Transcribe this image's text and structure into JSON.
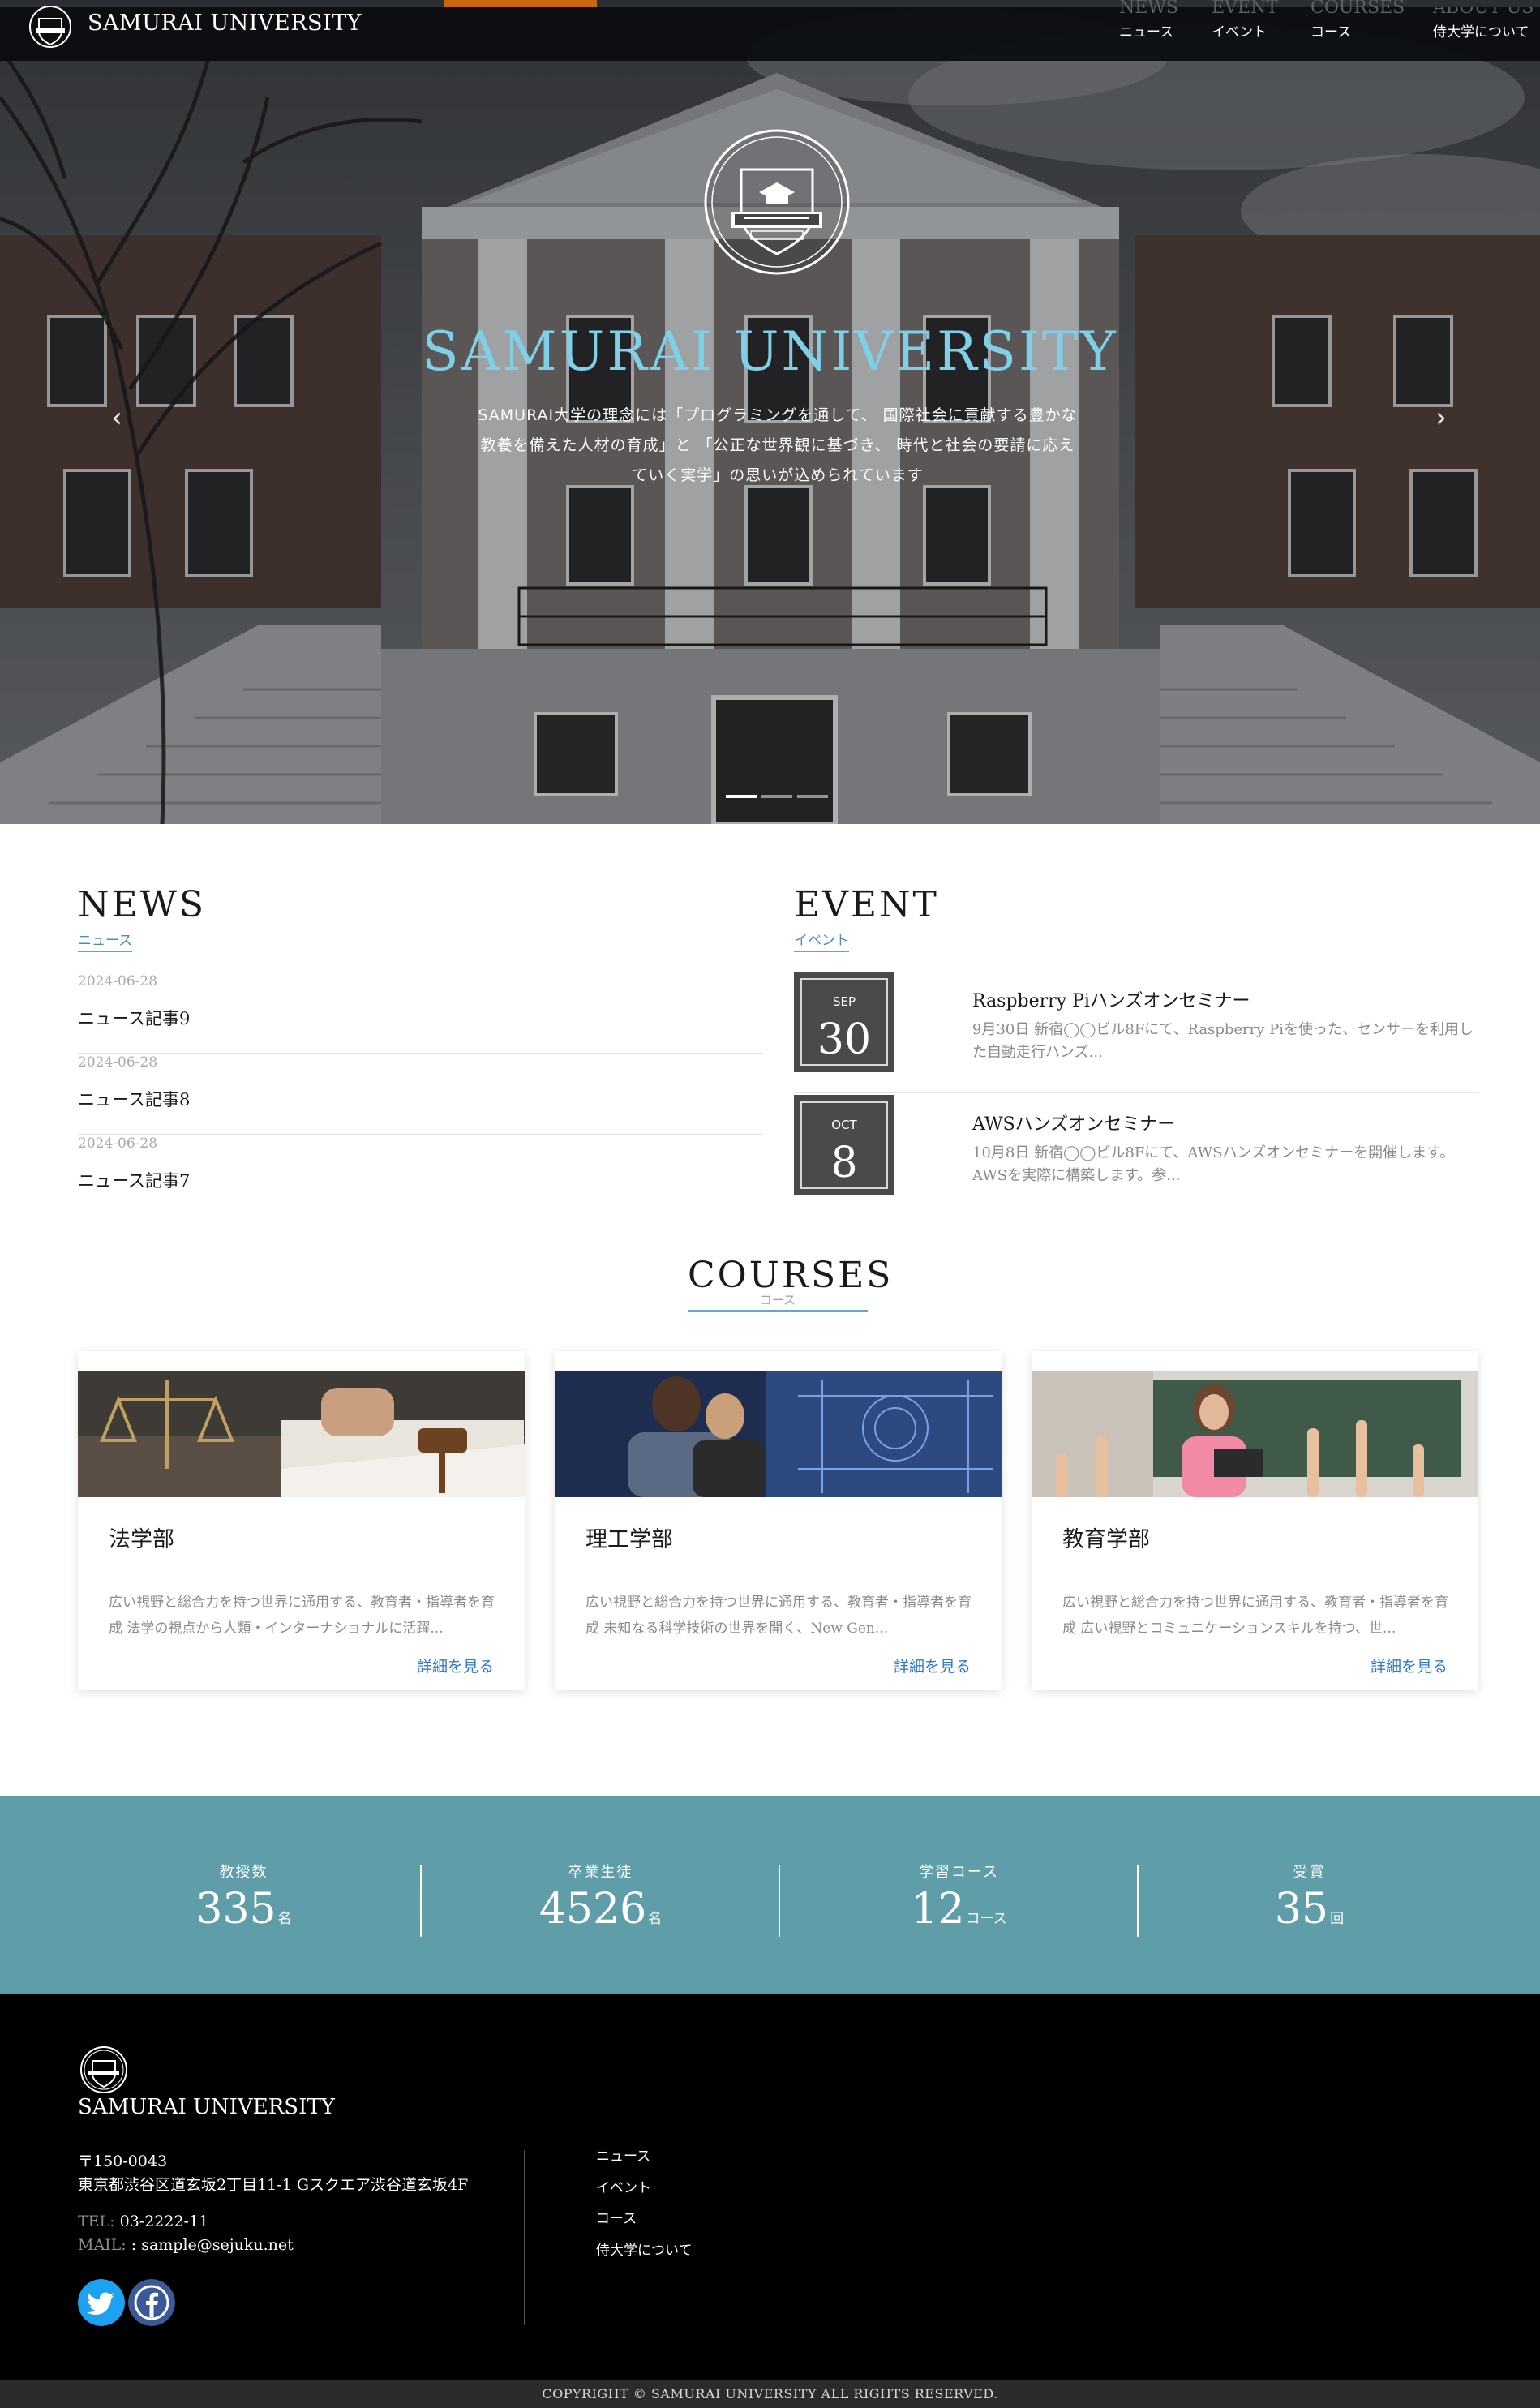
{
  "header": {
    "brand": "SAMURAI UNIVERSITY",
    "nav": [
      {
        "en": "NEWS",
        "jp": "ニュース"
      },
      {
        "en": "EVENT",
        "jp": "イベント"
      },
      {
        "en": "COURSES",
        "jp": "コース"
      },
      {
        "en": "ABOUT US",
        "jp": "侍大学について"
      }
    ]
  },
  "hero": {
    "title": "SAMURAI UNIVERSITY",
    "description_lines": [
      "SAMURAI大学の理念には「プログラミングを通して、 国際社会に貢献する豊かな",
      "教養を備えた人材の育成」と 「公正な世界観に基づき、 時代と社会の要請に応え",
      "ていく実学」の思いが込められています"
    ],
    "prev_icon": "chevron-left-icon",
    "next_icon": "chevron-right-icon",
    "slides": 3,
    "active_slide": 1
  },
  "news": {
    "en": "NEWS",
    "jp": "ニュース",
    "items": [
      {
        "date": "2024-06-28",
        "title": "ニュース記事9"
      },
      {
        "date": "2024-06-28",
        "title": "ニュース記事8"
      },
      {
        "date": "2024-06-28",
        "title": "ニュース記事7"
      }
    ]
  },
  "event": {
    "en": "EVENT",
    "jp": "イベント",
    "items": [
      {
        "month": "SEP",
        "day": "30",
        "title": "Raspberry Piハンズオンセミナー",
        "text": "9月30日 新宿◯◯ビル8Fにて、Raspberry Piを使った、センサーを利用した自動走行ハンズ..."
      },
      {
        "month": "OCT",
        "day": "8",
        "title": "AWSハンズオンセミナー",
        "text": "10月8日 新宿◯◯ビル8Fにて、AWSハンズオンセミナーを開催します。AWSを実際に構築します。参..."
      }
    ]
  },
  "courses": {
    "en": "COURSES",
    "jp": "コース",
    "items": [
      {
        "name": "法学部",
        "text": "広い視野と総合力を持つ世界に通用する、教育者・指導者を育成 法学の視点から人類・インターナショナルに活躍...",
        "more": "詳細を見る"
      },
      {
        "name": "理工学部",
        "text": "広い視野と総合力を持つ世界に通用する、教育者・指導者を育成 未知なる科学技術の世界を開く、New Gen...",
        "more": "詳細を見る"
      },
      {
        "name": "教育学部",
        "text": "広い視野と総合力を持つ世界に通用する、教育者・指導者を育成 広い視野とコミュニケーションスキルを持つ、世...",
        "more": "詳細を見る"
      }
    ]
  },
  "stats": [
    {
      "label": "教授数",
      "value": "335",
      "unit": "名"
    },
    {
      "label": "卒業生徒",
      "value": "4526",
      "unit": "名"
    },
    {
      "label": "学習コース",
      "value": "12",
      "unit": "コース"
    },
    {
      "label": "受賞",
      "value": "35",
      "unit": "回"
    }
  ],
  "footer": {
    "brand": "SAMURAI UNIVERSITY",
    "postal": "〒150-0043",
    "address": "東京都渋谷区道玄坂2丁目11-1 Gスクエア渋谷道玄坂4F",
    "tel_label": "TEL:",
    "tel": "03-2222-11",
    "mail_label": "MAIL:",
    "mail": ": sample@sejuku.net",
    "links": [
      "ニュース",
      "イベント",
      "コース",
      "侍大学について"
    ],
    "twitter_icon": "twitter-icon",
    "facebook_icon": "facebook-icon"
  },
  "copyright": "COPYRIGHT © SAMURAI UNIVERSITY ALL RIGHTS RESERVED.",
  "colors": {
    "accent": "#c9690f",
    "hero_title": "#7ecfe8",
    "stats_bg": "#5f9ea9",
    "link": "#2c7ad6",
    "underline": "#5fa8cc"
  }
}
